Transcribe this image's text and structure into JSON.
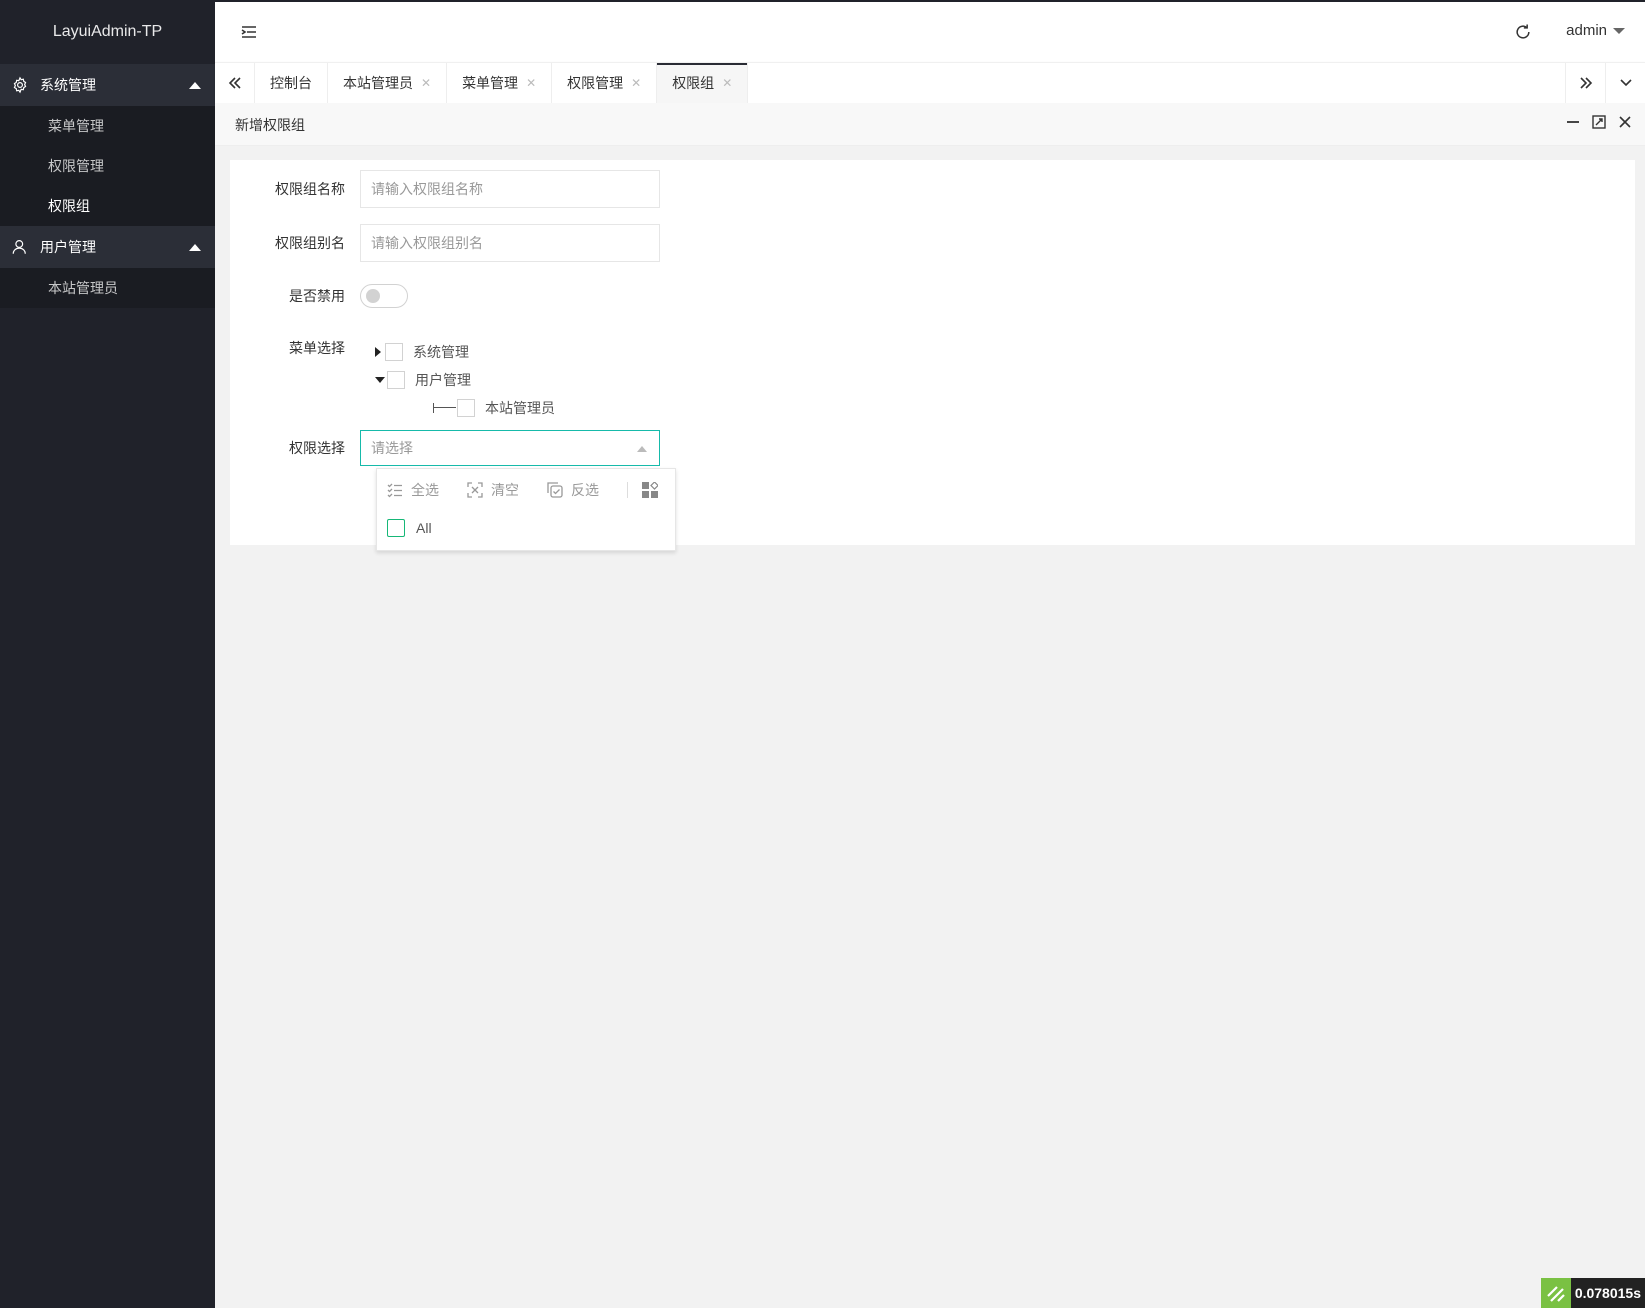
{
  "app": {
    "title": "LayuiAdmin-TP"
  },
  "sidebar": {
    "groups": [
      {
        "label": "系统管理",
        "icon": "gear-icon",
        "items": [
          "菜单管理",
          "权限管理",
          "权限组"
        ]
      },
      {
        "label": "用户管理",
        "icon": "user-icon",
        "items": [
          "本站管理员"
        ]
      }
    ]
  },
  "header": {
    "user": "admin"
  },
  "tabs": [
    "控制台",
    "本站管理员",
    "菜单管理",
    "权限管理",
    "权限组"
  ],
  "panel": {
    "title": "新增权限组"
  },
  "form": {
    "name_label": "权限组名称",
    "name_placeholder": "请输入权限组名称",
    "alias_label": "权限组别名",
    "alias_placeholder": "请输入权限组别名",
    "disabled_label": "是否禁用",
    "disabled_value": false,
    "menu_label": "菜单选择",
    "menu_tree": [
      {
        "label": "系统管理",
        "expanded": false
      },
      {
        "label": "用户管理",
        "expanded": true,
        "children": [
          "本站管理员"
        ]
      }
    ],
    "perm_label": "权限选择",
    "perm_placeholder": "请选择",
    "perm_tools": [
      "全选",
      "清空",
      "反选"
    ],
    "perm_options": [
      "All"
    ]
  },
  "timer": {
    "value": "0.078015s"
  },
  "colors": {
    "sidebar_bg": "#20222a",
    "accent": "#16baaa",
    "option_check": "#16b777"
  }
}
